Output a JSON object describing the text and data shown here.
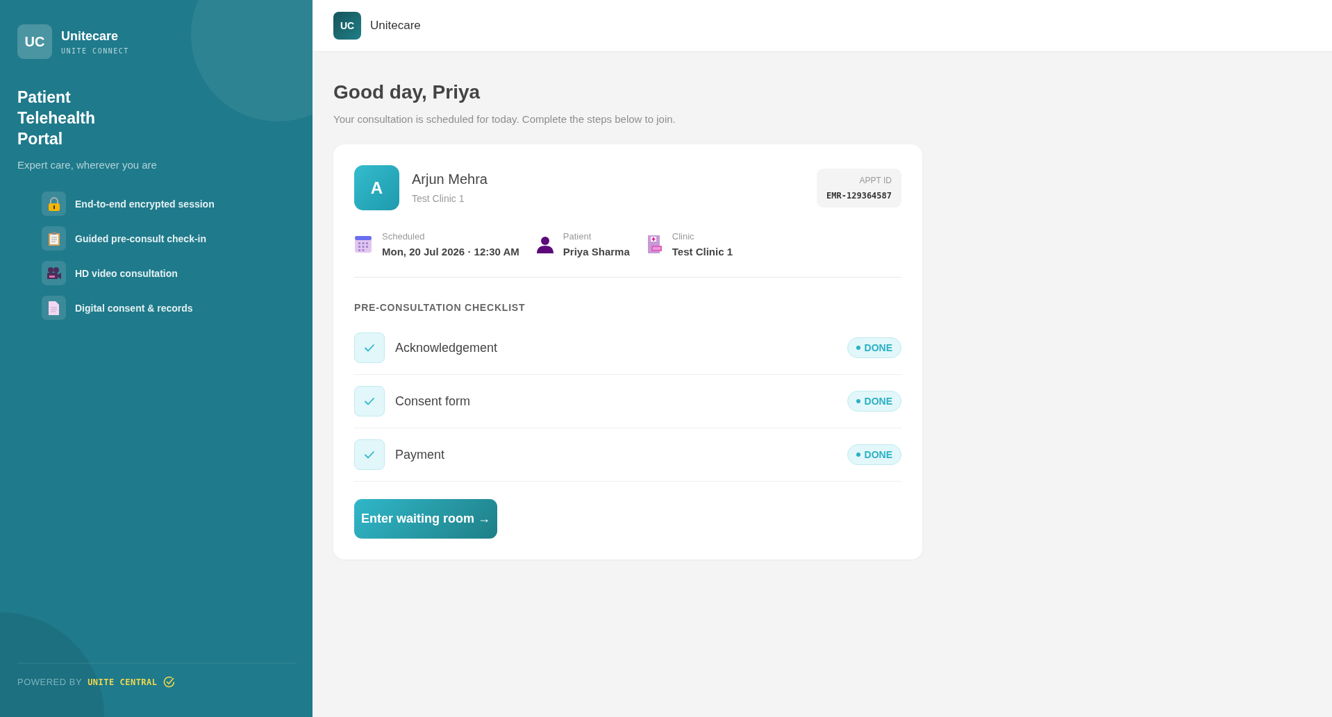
{
  "sidebar": {
    "logo": "UC",
    "brand": "Unitecare",
    "subbrand": "UNITE CONNECT",
    "title": "Patient Telehealth Portal",
    "tagline": "Expert care, wherever you are",
    "features": [
      {
        "label": "End-to-end encrypted session"
      },
      {
        "label": "Guided pre-consult check-in"
      },
      {
        "label": "HD video consultation"
      },
      {
        "label": "Digital consent & records"
      }
    ],
    "footer": {
      "prefix": "POWERED BY",
      "brand": "UNITE CENTRAL"
    }
  },
  "header": {
    "logo": "UC",
    "brand": "Unitecare"
  },
  "greeting": "Good day, Priya",
  "intro": "Your consultation is scheduled for today. Complete the steps below to join.",
  "appointment": {
    "avatar": "A",
    "doctor": "Arjun Mehra",
    "clinic": "Test Clinic 1",
    "appt_id_label": "APPT ID",
    "appt_id": "EMR-129364587",
    "details": [
      {
        "label": "Scheduled",
        "value": "Mon, 20 Jul 2026 · 12:30 AM"
      },
      {
        "label": "Patient",
        "value": "Priya Sharma"
      },
      {
        "label": "Clinic",
        "value": "Test Clinic 1"
      }
    ]
  },
  "checklist": {
    "title": "PRE-CONSULTATION CHECKLIST",
    "items": [
      {
        "label": "Acknowledgement",
        "checked": true,
        "status": "DONE"
      },
      {
        "label": "Consent form",
        "checked": true,
        "status": "DONE"
      },
      {
        "label": "Payment",
        "checked": true,
        "status": "DONE"
      }
    ]
  },
  "action": {
    "label": "Enter waiting room →"
  }
}
